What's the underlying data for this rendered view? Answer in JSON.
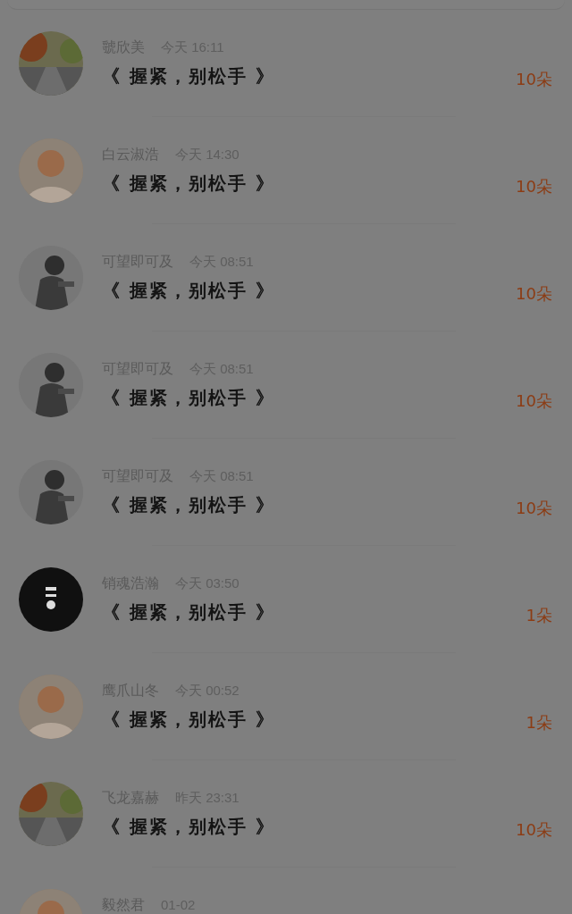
{
  "items": [
    {
      "name": "虢欣美",
      "time": "今天 16:11",
      "title": "《 握紧，别松手 》",
      "count": "10朵"
    },
    {
      "name": "白云淑浩",
      "time": "今天 14:30",
      "title": "《 握紧，别松手 》",
      "count": "10朵"
    },
    {
      "name": "可望即可及",
      "time": "今天 08:51",
      "title": "《 握紧，别松手 》",
      "count": "10朵"
    },
    {
      "name": "可望即可及",
      "time": "今天 08:51",
      "title": "《 握紧，别松手 》",
      "count": "10朵"
    },
    {
      "name": "可望即可及",
      "time": "今天 08:51",
      "title": "《 握紧，别松手 》",
      "count": "10朵"
    },
    {
      "name": "销魂浩瀚",
      "time": "今天 03:50",
      "title": "《 握紧，别松手 》",
      "count": "1朵"
    },
    {
      "name": "鹰爪山冬",
      "time": "今天 00:52",
      "title": "《 握紧，别松手 》",
      "count": "1朵"
    },
    {
      "name": "飞龙嘉赫",
      "time": "昨天 23:31",
      "title": "《 握紧，别松手 》",
      "count": "10朵"
    },
    {
      "name": "毅然君",
      "time": "01-02"
    }
  ]
}
